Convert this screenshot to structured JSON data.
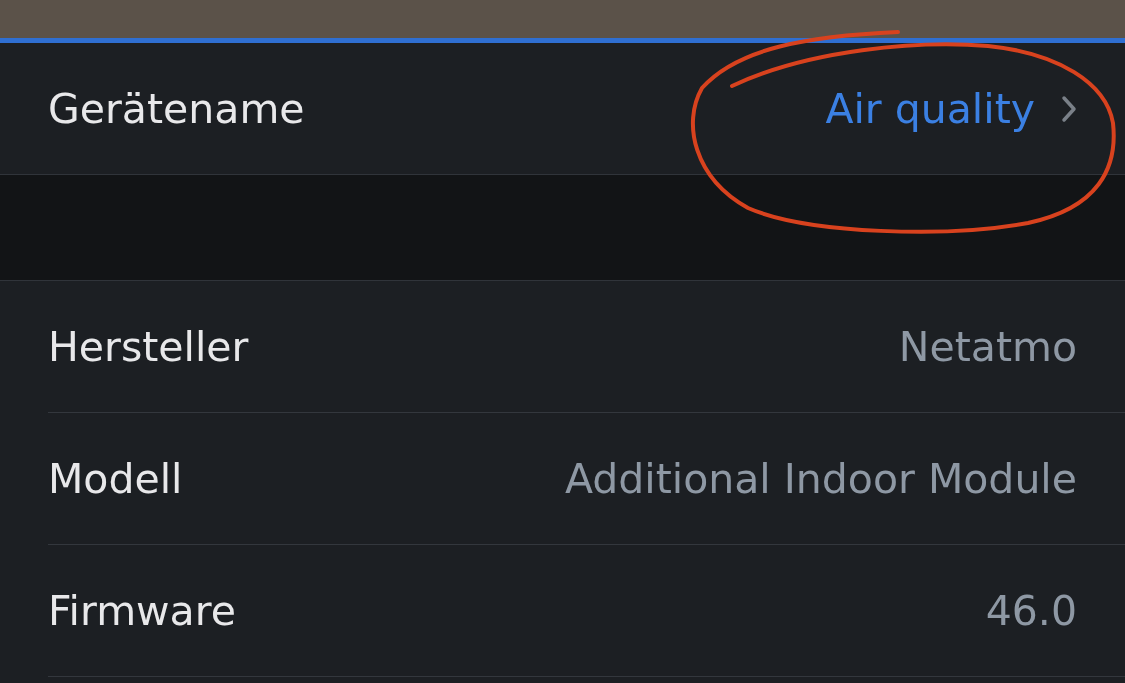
{
  "device_name": {
    "label": "Gerätename",
    "value": "Air quality"
  },
  "info_rows": [
    {
      "label": "Hersteller",
      "value": "Netatmo"
    },
    {
      "label": "Modell",
      "value": "Additional Indoor Module"
    },
    {
      "label": "Firmware",
      "value": "46.0"
    }
  ]
}
